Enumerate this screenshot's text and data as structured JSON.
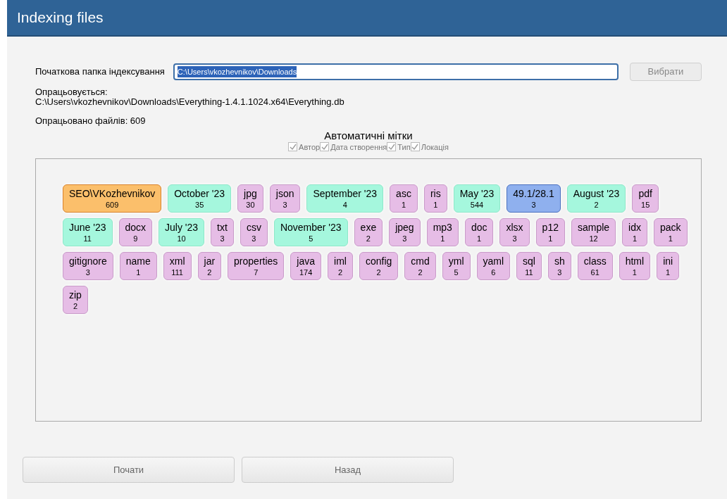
{
  "window": {
    "title": "Indexing files"
  },
  "folder": {
    "label": "Початкова папка індексування",
    "value": "C:\\Users\\vkozhevnikov\\Downloads",
    "button": "Вибрати"
  },
  "processing": {
    "label": "Опрацьовується:",
    "path": "C:\\Users\\vkozhevnikov\\Downloads\\Everything-1.4.1.1024.x64\\Everything.db"
  },
  "processed_count": "Опрацьовано файлів: 609",
  "auto_tags": {
    "title": "Автоматичні мітки",
    "options": [
      {
        "label": "Автор",
        "checked": true
      },
      {
        "label": "Дата створення",
        "checked": true
      },
      {
        "label": "Тип",
        "checked": true
      },
      {
        "label": "Локація",
        "checked": true
      }
    ]
  },
  "tags": [
    {
      "kind": "author",
      "name": "SEO\\VKozhevnikov",
      "count": "609"
    },
    {
      "kind": "date",
      "name": "October '23",
      "count": "35"
    },
    {
      "kind": "type",
      "name": "jpg",
      "count": "30"
    },
    {
      "kind": "type",
      "name": "json",
      "count": "3"
    },
    {
      "kind": "date",
      "name": "September '23",
      "count": "4"
    },
    {
      "kind": "type",
      "name": "asc",
      "count": "1"
    },
    {
      "kind": "type",
      "name": "ris",
      "count": "1"
    },
    {
      "kind": "date",
      "name": "May '23",
      "count": "544"
    },
    {
      "kind": "location",
      "name": "49.1/28.1",
      "count": "3"
    },
    {
      "kind": "date",
      "name": "August '23",
      "count": "2"
    },
    {
      "kind": "type",
      "name": "pdf",
      "count": "15"
    },
    {
      "kind": "date",
      "name": "June '23",
      "count": "11"
    },
    {
      "kind": "type",
      "name": "docx",
      "count": "9"
    },
    {
      "kind": "date",
      "name": "July '23",
      "count": "10"
    },
    {
      "kind": "type",
      "name": "txt",
      "count": "3"
    },
    {
      "kind": "type",
      "name": "csv",
      "count": "3"
    },
    {
      "kind": "date",
      "name": "November '23",
      "count": "5"
    },
    {
      "kind": "type",
      "name": "exe",
      "count": "2"
    },
    {
      "kind": "type",
      "name": "jpeg",
      "count": "3"
    },
    {
      "kind": "type",
      "name": "mp3",
      "count": "1"
    },
    {
      "kind": "type",
      "name": "doc",
      "count": "1"
    },
    {
      "kind": "type",
      "name": "xlsx",
      "count": "3"
    },
    {
      "kind": "type",
      "name": "p12",
      "count": "1"
    },
    {
      "kind": "type",
      "name": "sample",
      "count": "12"
    },
    {
      "kind": "type",
      "name": "idx",
      "count": "1"
    },
    {
      "kind": "type",
      "name": "pack",
      "count": "1"
    },
    {
      "kind": "type",
      "name": "gitignore",
      "count": "3"
    },
    {
      "kind": "type",
      "name": "name",
      "count": "1"
    },
    {
      "kind": "type",
      "name": "xml",
      "count": "111"
    },
    {
      "kind": "type",
      "name": "jar",
      "count": "2"
    },
    {
      "kind": "type",
      "name": "properties",
      "count": "7"
    },
    {
      "kind": "type",
      "name": "java",
      "count": "174"
    },
    {
      "kind": "type",
      "name": "iml",
      "count": "2"
    },
    {
      "kind": "type",
      "name": "config",
      "count": "2"
    },
    {
      "kind": "type",
      "name": "cmd",
      "count": "2"
    },
    {
      "kind": "type",
      "name": "yml",
      "count": "5"
    },
    {
      "kind": "type",
      "name": "yaml",
      "count": "6"
    },
    {
      "kind": "type",
      "name": "sql",
      "count": "11"
    },
    {
      "kind": "type",
      "name": "sh",
      "count": "3"
    },
    {
      "kind": "type",
      "name": "class",
      "count": "61"
    },
    {
      "kind": "type",
      "name": "html",
      "count": "1"
    },
    {
      "kind": "type",
      "name": "ini",
      "count": "1"
    },
    {
      "kind": "type",
      "name": "zip",
      "count": "2"
    }
  ],
  "buttons": [
    "Почати",
    "Назад"
  ]
}
